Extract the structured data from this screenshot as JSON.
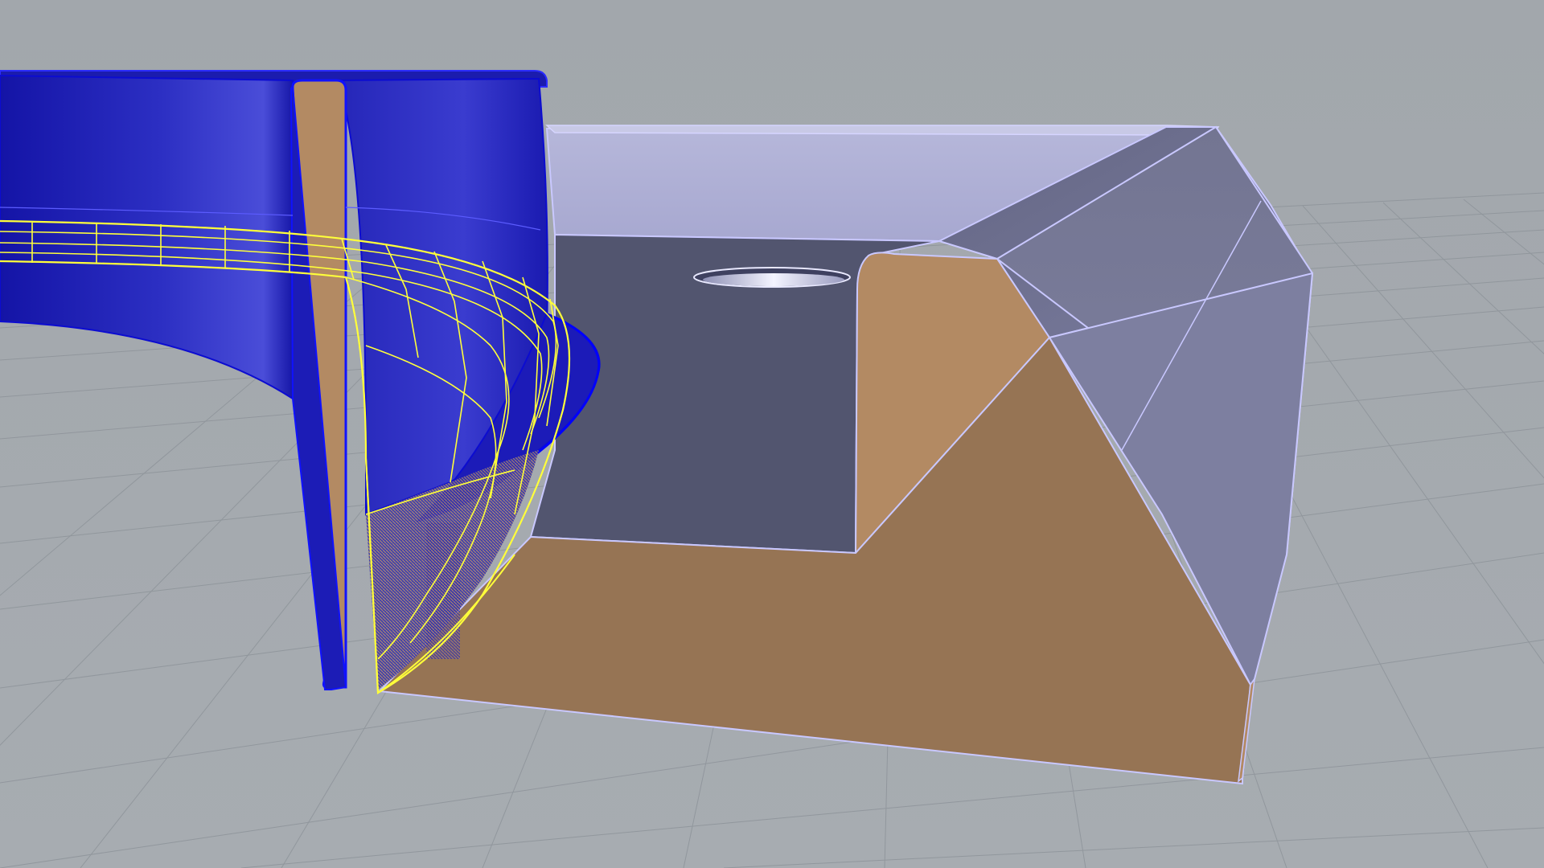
{
  "viewport": {
    "view": "perspective",
    "display_mode": "shaded",
    "background_color": "#a3a8ad",
    "grid_color": "#8f959b",
    "grid_visible": true
  },
  "colors": {
    "selection_blue": "#1f20b4",
    "section_cut_fill": "#b38a63",
    "tray_face": "#52556f",
    "tray_top": "#9c9ec4",
    "edge_highlight": "#c9c8ff",
    "isocurve_yellow": "#ffff3a"
  },
  "objects": [
    {
      "id": "curved-ring",
      "state": "selected",
      "cut_by_section": true
    },
    {
      "id": "tray-block",
      "state": "normal",
      "cut_by_section": true,
      "features": [
        "through-hole",
        "rounded-lip",
        "chamfered-rim"
      ]
    },
    {
      "id": "control-surface",
      "state": "highlighted",
      "display": "isocurves"
    }
  ]
}
